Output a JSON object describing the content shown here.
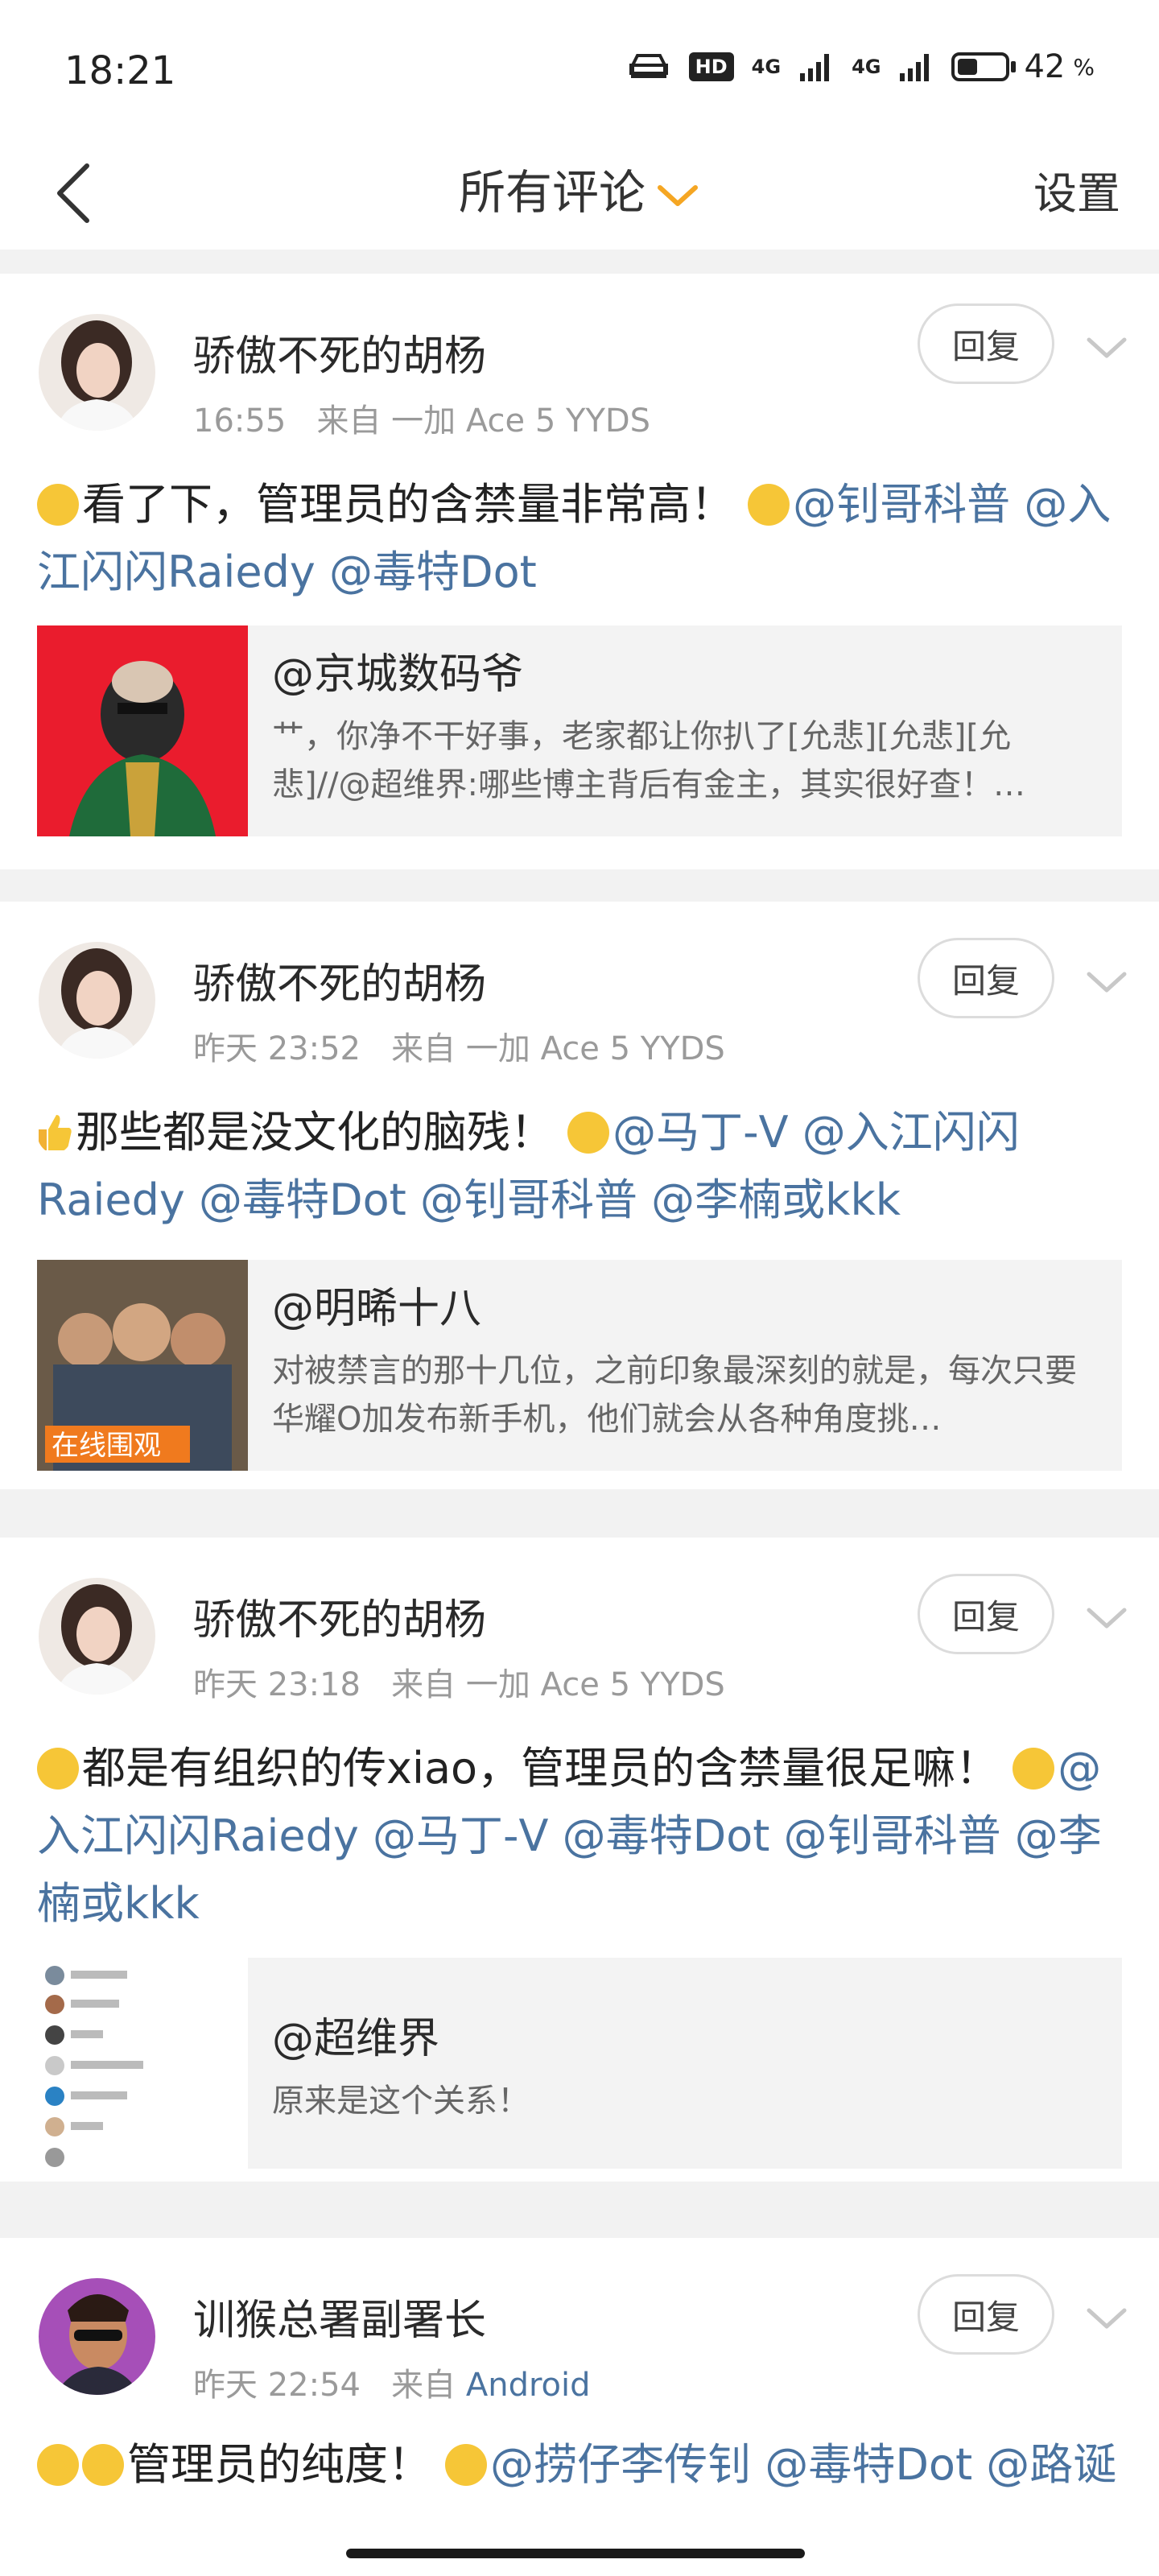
{
  "status_bar": {
    "time": "18:21",
    "hd": "HD",
    "net1": "4G",
    "net2": "4G",
    "battery": "42",
    "battery_unit": "%"
  },
  "nav": {
    "title": "所有评论",
    "settings": "设置",
    "accent_color": "#f5a623"
  },
  "comments": [
    {
      "user": "骄傲不死的胡杨",
      "time": "16:55",
      "from_label": "来自",
      "source": "一加 Ace 5 YYDS",
      "reply": "回复",
      "lead_emoji": "smirk-emoji-icon",
      "text_plain": "看了下，管理员的含禁量非常高！",
      "mid_emoji": "thinking-emoji-icon",
      "mentions": "@钊哥科普 @入江闪闪Raiedy @毒特Dot",
      "quote": {
        "title": "@京城数码爷",
        "text": "艹，你净不干好事，老家都让你扒了[允悲][允悲][允悲]//@超维界:哪些博主背后有金主，其实很好查！…"
      }
    },
    {
      "user": "骄傲不死的胡杨",
      "time": "昨天 23:52",
      "from_label": "来自",
      "source": "一加 Ace 5 YYDS",
      "reply": "回复",
      "lead_emoji": "thumbs-up-emoji-icon",
      "text_plain": "那些都是没文化的脑残！",
      "mid_emoji": "yum-emoji-icon",
      "mentions": "@马丁-V @入江闪闪Raiedy @毒特Dot @钊哥科普 @李楠或kkk",
      "quote": {
        "title": "@明晞十八",
        "text": "对被禁言的那十几位，之前印象最深刻的就是，每次只要华耀O加发布新手机，他们就会从各种角度挑…",
        "img_caption": "在线围观"
      }
    },
    {
      "user": "骄傲不死的胡杨",
      "time": "昨天 23:18",
      "from_label": "来自",
      "source": "一加 Ace 5 YYDS",
      "reply": "回复",
      "lead_emoji": "thinking-emoji-icon",
      "text_plain": "都是有组织的传xiao，管理员的含禁量很足嘛！",
      "mid_emoji": "smirk-emoji-icon",
      "mentions": "@入江闪闪Raiedy @马丁-V @毒特Dot @钊哥科普 @李楠或kkk",
      "quote": {
        "title": "@超维界",
        "text": "原来是这个关系！"
      }
    },
    {
      "user": "训猴总署副署长",
      "time": "昨天 22:54",
      "from_label": "来自",
      "source": "Android",
      "reply": "回复",
      "lead_emoji": "thinking-emoji-icon",
      "text_plain": "管理员的纯度！",
      "mid_emoji": "grin-emoji-icon",
      "mentions": "@捞仔李传钊 @毒特Dot @路诞"
    }
  ]
}
